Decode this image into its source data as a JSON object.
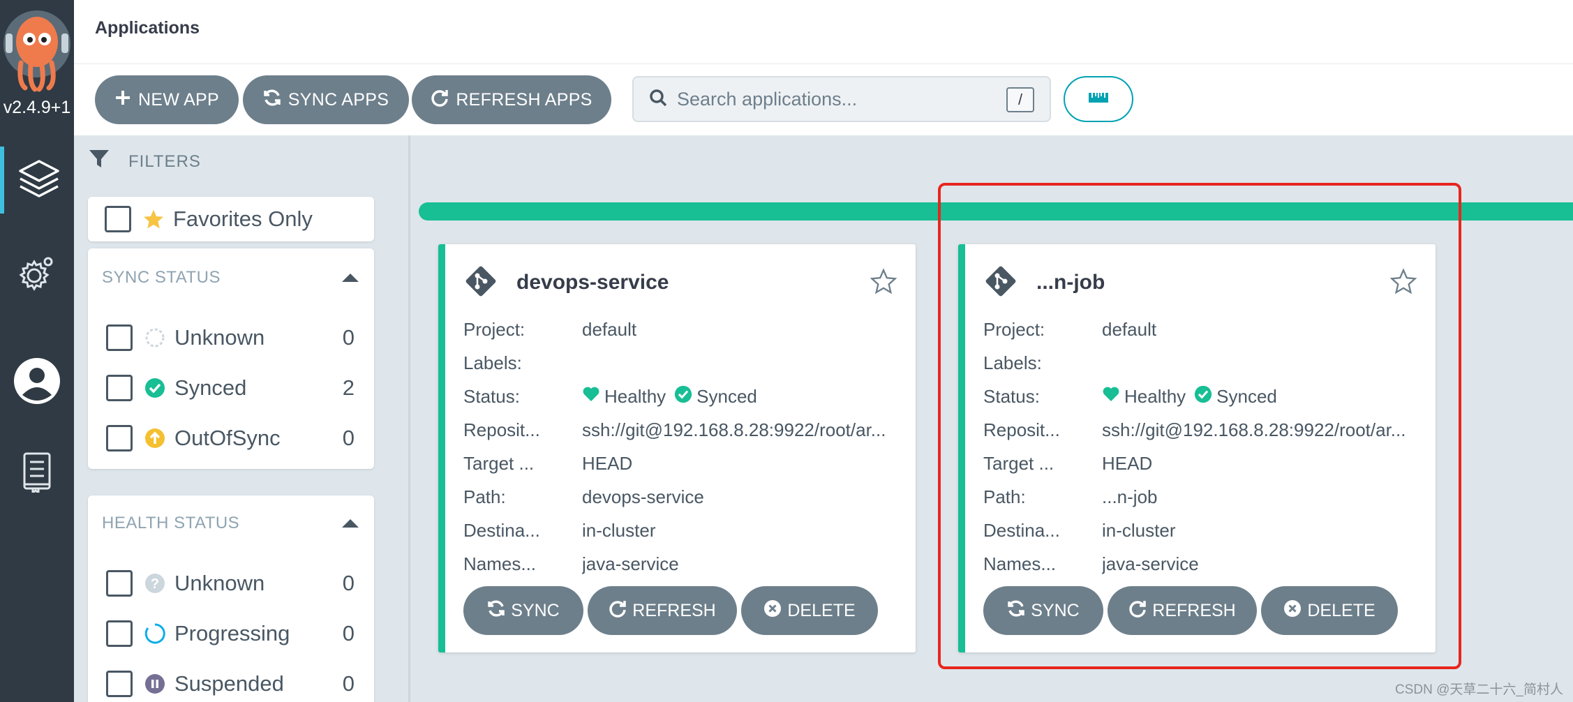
{
  "nav": {
    "version": "v2.4.9+1",
    "items": [
      {
        "icon": "layers-icon",
        "active": true
      },
      {
        "icon": "gear-icon",
        "active": false
      },
      {
        "icon": "user-icon",
        "active": false
      },
      {
        "icon": "docs-icon",
        "active": false
      }
    ]
  },
  "header": {
    "title": "Applications"
  },
  "toolbar": {
    "new_app": "NEW APP",
    "sync_apps": "SYNC APPS",
    "refresh_apps": "REFRESH APPS",
    "search_placeholder": "Search applications...",
    "search_shortcut": "/"
  },
  "filters": {
    "title": "FILTERS",
    "favorites": "Favorites Only",
    "sync_status": {
      "title": "SYNC STATUS",
      "items": [
        {
          "label": "Unknown",
          "count": "0"
        },
        {
          "label": "Synced",
          "count": "2"
        },
        {
          "label": "OutOfSync",
          "count": "0"
        }
      ]
    },
    "health_status": {
      "title": "HEALTH STATUS",
      "items": [
        {
          "label": "Unknown",
          "count": "0"
        },
        {
          "label": "Progressing",
          "count": "0"
        },
        {
          "label": "Suspended",
          "count": "0"
        }
      ]
    }
  },
  "apps": [
    {
      "name": "devops-service",
      "fields": {
        "project_label": "Project:",
        "project": "default",
        "labels_label": "Labels:",
        "labels": "",
        "status_label": "Status:",
        "health": "Healthy",
        "sync": "Synced",
        "repo_label": "Reposit...",
        "repo": "ssh://git@192.168.8.28:9922/root/ar...",
        "target_label": "Target ...",
        "target": "HEAD",
        "path_label": "Path:",
        "path": "devops-service",
        "dest_label": "Destina...",
        "dest": "in-cluster",
        "ns_label": "Names...",
        "ns": "java-service"
      },
      "actions": {
        "sync": "SYNC",
        "refresh": "REFRESH",
        "delete": "DELETE"
      }
    },
    {
      "name": "...n-job",
      "fields": {
        "project_label": "Project:",
        "project": "default",
        "labels_label": "Labels:",
        "labels": "",
        "status_label": "Status:",
        "health": "Healthy",
        "sync": "Synced",
        "repo_label": "Reposit...",
        "repo": "ssh://git@192.168.8.28:9922/root/ar...",
        "target_label": "Target ...",
        "target": "HEAD",
        "path_label": "Path:",
        "path": "...n-job",
        "dest_label": "Destina...",
        "dest": "in-cluster",
        "ns_label": "Names...",
        "ns": "java-service"
      },
      "actions": {
        "sync": "SYNC",
        "refresh": "REFRESH",
        "delete": "DELETE"
      }
    }
  ],
  "colors": {
    "accent": "#18be94",
    "nav_bg": "#2f3a44",
    "button": "#6d7f8b",
    "highlight": "#e8261e",
    "out_of_sync": "#f4c030",
    "progressing": "#0dadea",
    "suspended": "#766f94"
  },
  "watermark": "CSDN @天草二十六_简村人"
}
